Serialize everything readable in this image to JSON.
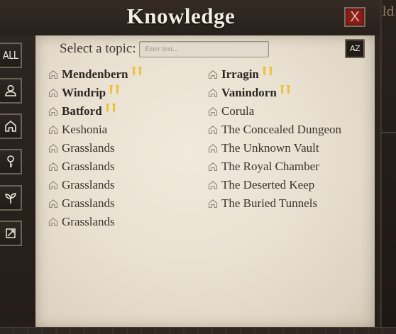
{
  "window": {
    "title": "Knowledge",
    "close_label": "X"
  },
  "background": {
    "partial_text": "old"
  },
  "sidebar": {
    "all_label": "ALL",
    "buttons": [
      "all",
      "person-icon",
      "home-icon",
      "key-icon",
      "plant-icon",
      "map-icon"
    ]
  },
  "search": {
    "label": "Select a topic:",
    "placeholder": "Enter text...",
    "value": "",
    "sort_label": "AZ"
  },
  "topics": {
    "column1": [
      {
        "name": "Mendenbern",
        "bold": true,
        "quest": true
      },
      {
        "name": "Windrip",
        "bold": true,
        "quest": true
      },
      {
        "name": "Batford",
        "bold": true,
        "quest": true
      },
      {
        "name": "Keshonia",
        "bold": false,
        "quest": false
      },
      {
        "name": "Grasslands",
        "bold": false,
        "quest": false
      },
      {
        "name": "Grasslands",
        "bold": false,
        "quest": false
      },
      {
        "name": "Grasslands",
        "bold": false,
        "quest": false
      },
      {
        "name": "Grasslands",
        "bold": false,
        "quest": false
      },
      {
        "name": "Grasslands",
        "bold": false,
        "quest": false
      }
    ],
    "column2": [
      {
        "name": "Irragin",
        "bold": true,
        "quest": true
      },
      {
        "name": "Vanindorn",
        "bold": true,
        "quest": true
      },
      {
        "name": "Corula",
        "bold": false,
        "quest": false
      },
      {
        "name": "The Concealed Dungeon",
        "bold": false,
        "quest": false
      },
      {
        "name": "The Unknown Vault",
        "bold": false,
        "quest": false
      },
      {
        "name": "The Royal Chamber",
        "bold": false,
        "quest": false
      },
      {
        "name": "The Deserted Keep",
        "bold": false,
        "quest": false
      },
      {
        "name": "The Buried Tunnels",
        "bold": false,
        "quest": false
      }
    ]
  },
  "colors": {
    "parchment": "#e9e1d2",
    "frame": "#241d18",
    "close_button": "#8a1f1a",
    "quest_marker": "#e8b92a",
    "topic_text": "#3a332c"
  }
}
